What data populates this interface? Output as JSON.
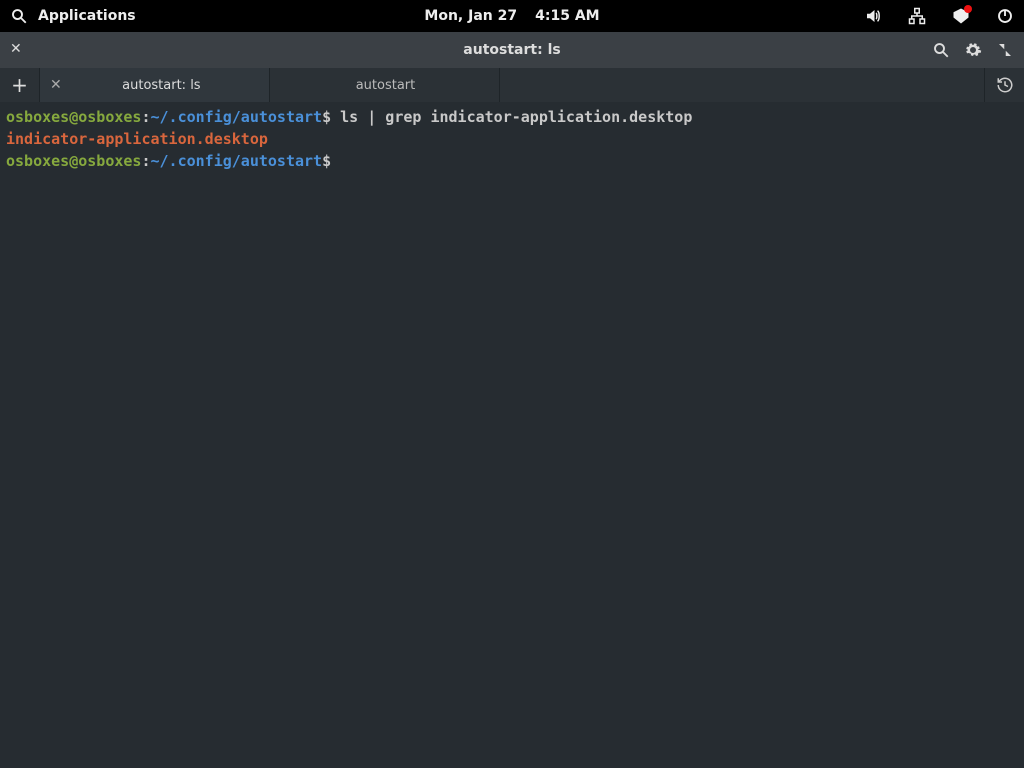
{
  "topbar": {
    "applications_label": "Applications",
    "date": "Mon, Jan 27",
    "time": "4:15 AM"
  },
  "window": {
    "title": "autostart: ls",
    "close_glyph": "✕"
  },
  "tabs": {
    "new_glyph": "+",
    "items": [
      {
        "label": "autostart: ls",
        "active": true,
        "close_glyph": "✕"
      },
      {
        "label": "autostart",
        "active": false,
        "close_glyph": ""
      }
    ]
  },
  "terminal": {
    "lines": [
      {
        "user": "osboxes@osboxes",
        "sep1": ":",
        "path": "~/.config/autostart",
        "sigil": "$",
        "cmd": " ls | grep indicator-application.desktop"
      }
    ],
    "output": "indicator-application.desktop",
    "prompt2": {
      "user": "osboxes@osboxes",
      "sep1": ":",
      "path": "~/.config/autostart",
      "sigil": "$"
    }
  }
}
